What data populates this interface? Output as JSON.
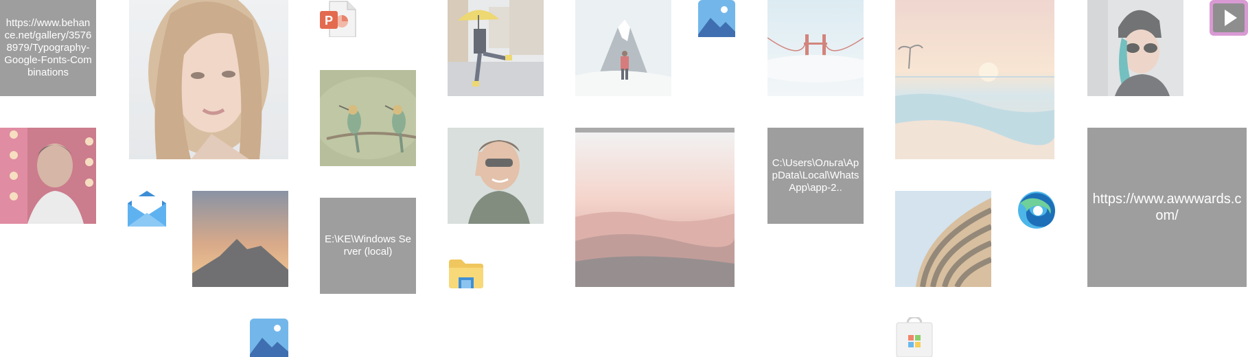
{
  "tiles": {
    "url_behance": "https://www.behance.net/gallery/35768979/Typography-Google-Fonts-Combinations",
    "path_whatsapp": "C:\\Users\\Ольга\\AppData\\Local\\WhatsApp\\app-2..",
    "path_windows_server": "E:\\KE\\Windows Server (local)",
    "url_awwwards": "https://www.awwwards.com/"
  },
  "icons": [
    "powerpoint-icon",
    "photos-icon",
    "mail-icon",
    "file-explorer-icon",
    "edge-icon",
    "video-icon",
    "microsoft-store-icon"
  ],
  "colors": {
    "text_tile_bg": "#9e9e9e",
    "text_tile_fg": "#ffffff",
    "background": "#ffffff"
  }
}
